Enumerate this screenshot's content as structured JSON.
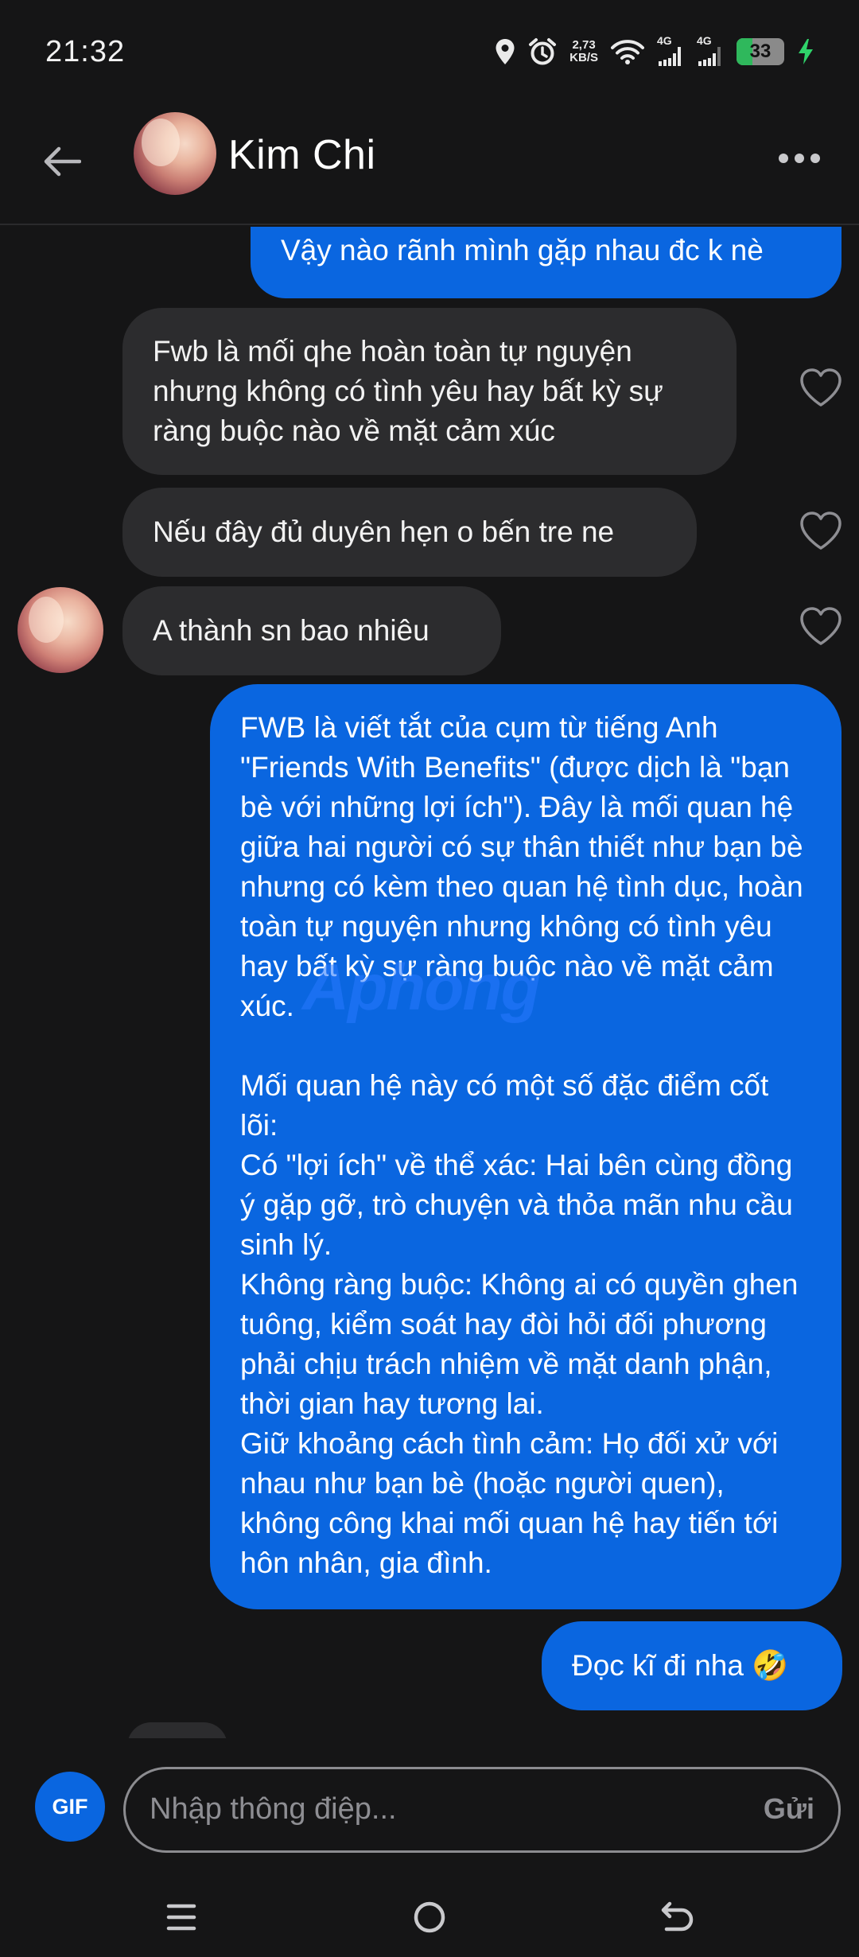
{
  "status_bar": {
    "time": "21:32",
    "net_speed_value": "2,73",
    "net_speed_unit": "KB/S",
    "network_1": "4G",
    "network_2": "4G",
    "battery": "33"
  },
  "header": {
    "contact_name": "Kim Chi",
    "back_icon": "arrow-left-icon",
    "more_icon": "more-horizontal-icon"
  },
  "messages": [
    {
      "direction": "outgoing",
      "text": "Vậy nào rãnh mình gặp nhau đc k nè"
    },
    {
      "direction": "incoming",
      "text": "Fwb là mối qhe hoàn toàn tự nguyện nhưng không có tình yêu hay bất kỳ sự ràng buộc nào về mặt cảm xúc"
    },
    {
      "direction": "incoming",
      "text": "Nếu đây đủ duyên hẹn o bến tre ne"
    },
    {
      "direction": "incoming",
      "text": "A thành sn bao nhiêu"
    },
    {
      "direction": "outgoing",
      "text": "FWB là viết tắt của cụm từ tiếng Anh \"Friends With Benefits\" (được dịch là \"bạn bè với những lợi ích\"). Đây là mối quan hệ giữa hai người có sự thân thiết như bạn bè nhưng có kèm theo quan hệ tình dục, hoàn toàn tự nguyện nhưng không có tình yêu hay bất kỳ sự ràng buộc nào về mặt cảm xúc.\n\nMối quan hệ này có một số đặc điểm cốt lõi:\nCó \"lợi ích\" về thể xác: Hai bên cùng đồng ý gặp gỡ, trò chuyện và thỏa mãn nhu cầu sinh lý.\nKhông ràng buộc: Không ai có quyền ghen tuông, kiểm soát hay đòi hỏi đối phương phải chịu trách nhiệm về mặt danh phận, thời gian hay tương lai.\nGiữ khoảng cách tình cảm: Họ đối xử với nhau như bạn bè (hoặc người quen), không công khai mối quan hệ hay tiến tới hôn nhân, gia đình."
    },
    {
      "direction": "outgoing",
      "text": "Đọc kĩ đi nha 🤣"
    }
  ],
  "watermark": "Aphong",
  "composer": {
    "gif_label": "GIF",
    "placeholder": "Nhập thông điệp...",
    "send_label": "Gửi"
  },
  "colors": {
    "outgoing_bubble": "#0a66e0",
    "incoming_bubble": "#2c2c2e",
    "background": "#151516"
  }
}
